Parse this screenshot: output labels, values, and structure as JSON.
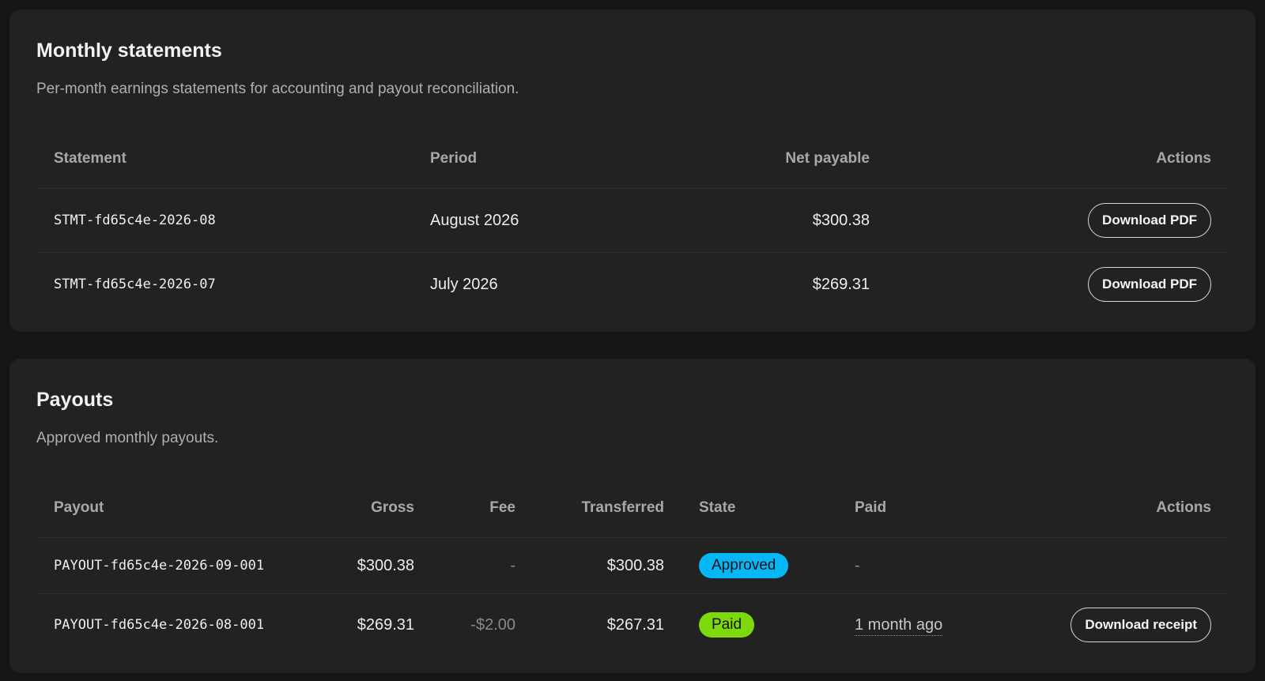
{
  "colors": {
    "background": "#161618",
    "card": "#222222",
    "approved": "#06b6f5",
    "paid": "#7ed90c"
  },
  "statements": {
    "title": "Monthly statements",
    "description": "Per-month earnings statements for accounting and payout reconciliation.",
    "headers": {
      "statement": "Statement",
      "period": "Period",
      "net_payable": "Net payable",
      "actions": "Actions"
    },
    "rows": [
      {
        "id": "STMT-fd65c4e-2026-08",
        "period": "August 2026",
        "net_payable": "$300.38",
        "action": "Download PDF"
      },
      {
        "id": "STMT-fd65c4e-2026-07",
        "period": "July 2026",
        "net_payable": "$269.31",
        "action": "Download PDF"
      }
    ]
  },
  "payouts": {
    "title": "Payouts",
    "description": "Approved monthly payouts.",
    "headers": {
      "payout": "Payout",
      "gross": "Gross",
      "fee": "Fee",
      "transferred": "Transferred",
      "state": "State",
      "paid": "Paid",
      "actions": "Actions"
    },
    "rows": [
      {
        "id": "PAYOUT-fd65c4e-2026-09-001",
        "gross": "$300.38",
        "fee": "-",
        "transferred": "$300.38",
        "state": "Approved",
        "paid": "-",
        "action": ""
      },
      {
        "id": "PAYOUT-fd65c4e-2026-08-001",
        "gross": "$269.31",
        "fee": "-$2.00",
        "transferred": "$267.31",
        "state": "Paid",
        "paid": "1 month ago",
        "action": "Download receipt"
      }
    ]
  }
}
